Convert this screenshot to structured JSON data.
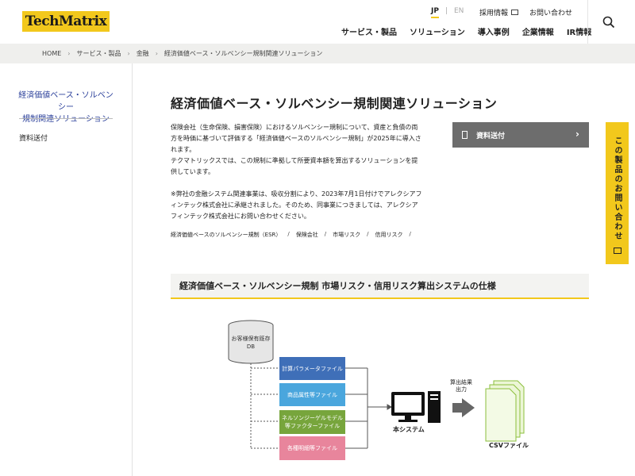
{
  "header": {
    "logo_text": "TechMatrix",
    "lang_jp": "JP",
    "lang_sep": "|",
    "lang_en": "EN",
    "recruit": "採用情報",
    "contact": "お問い合わせ",
    "nav": [
      "サービス・製品",
      "ソリューション",
      "導入事例",
      "企業情報",
      "IR情報"
    ],
    "search_icon": "search-icon"
  },
  "breadcrumb": [
    "HOME",
    "サービス・製品",
    "金融",
    "経済価値ベース・ソルベンシー規制関連ソリューション"
  ],
  "sidebar": {
    "title_line1": "経済価値ベース・ソルベンシー",
    "title_line2": "規制関連ソリューション",
    "item": "資料送付"
  },
  "main": {
    "title": "経済価値ベース・ソルベンシー規制関連ソリューション",
    "intro_lines": [
      "保険会社（生命保険、損害保険）におけるソルベンシー規制について、資産と負債の両",
      "方を時価に基づいて評価する「経済価値ベースのソルベンシー規制」が2025年に導入さ",
      "れます。",
      "テクマトリックスでは、この規制に準拠して所要資本額を算出するソリューションを提",
      "供しています。"
    ],
    "note_lines": [
      "※弊社の金融システム関連事業は、吸収分割により、2023年7月1日付けでアレクシアフ",
      "ィンテック株式会社に承継されました。そのため、同事業につきましては、アレクシア",
      "フィンテック株式会社にお問い合わせください。"
    ],
    "tags": [
      "経済価値ベースのソルベンシー規制（ESR）",
      "保険会社",
      "市場リスク",
      "信用リスク"
    ],
    "tag_sep": "/",
    "doc_button": "資料送付",
    "section_title": "経済価値ベース・ソルベンシー規制 市場リスク・信用リスク算出システムの仕様"
  },
  "side_tab": {
    "label": "この製品のお問い合わせ"
  },
  "diagram": {
    "db": "お客様保有既存DB",
    "boxes": [
      "計算パラメータファイル",
      "商品属性等ファイル",
      "ネルソンジーゲルモデル等ファクターファイル",
      "各種明細等ファイル"
    ],
    "system": "本システム",
    "output": "算出結果出力",
    "csv": "CSVファイル",
    "colors": {
      "b1": "#3f6fb8",
      "b2": "#4aa6dd",
      "b3": "#77a53c",
      "b4": "#e8859c",
      "accent": "#f2c81c"
    }
  }
}
